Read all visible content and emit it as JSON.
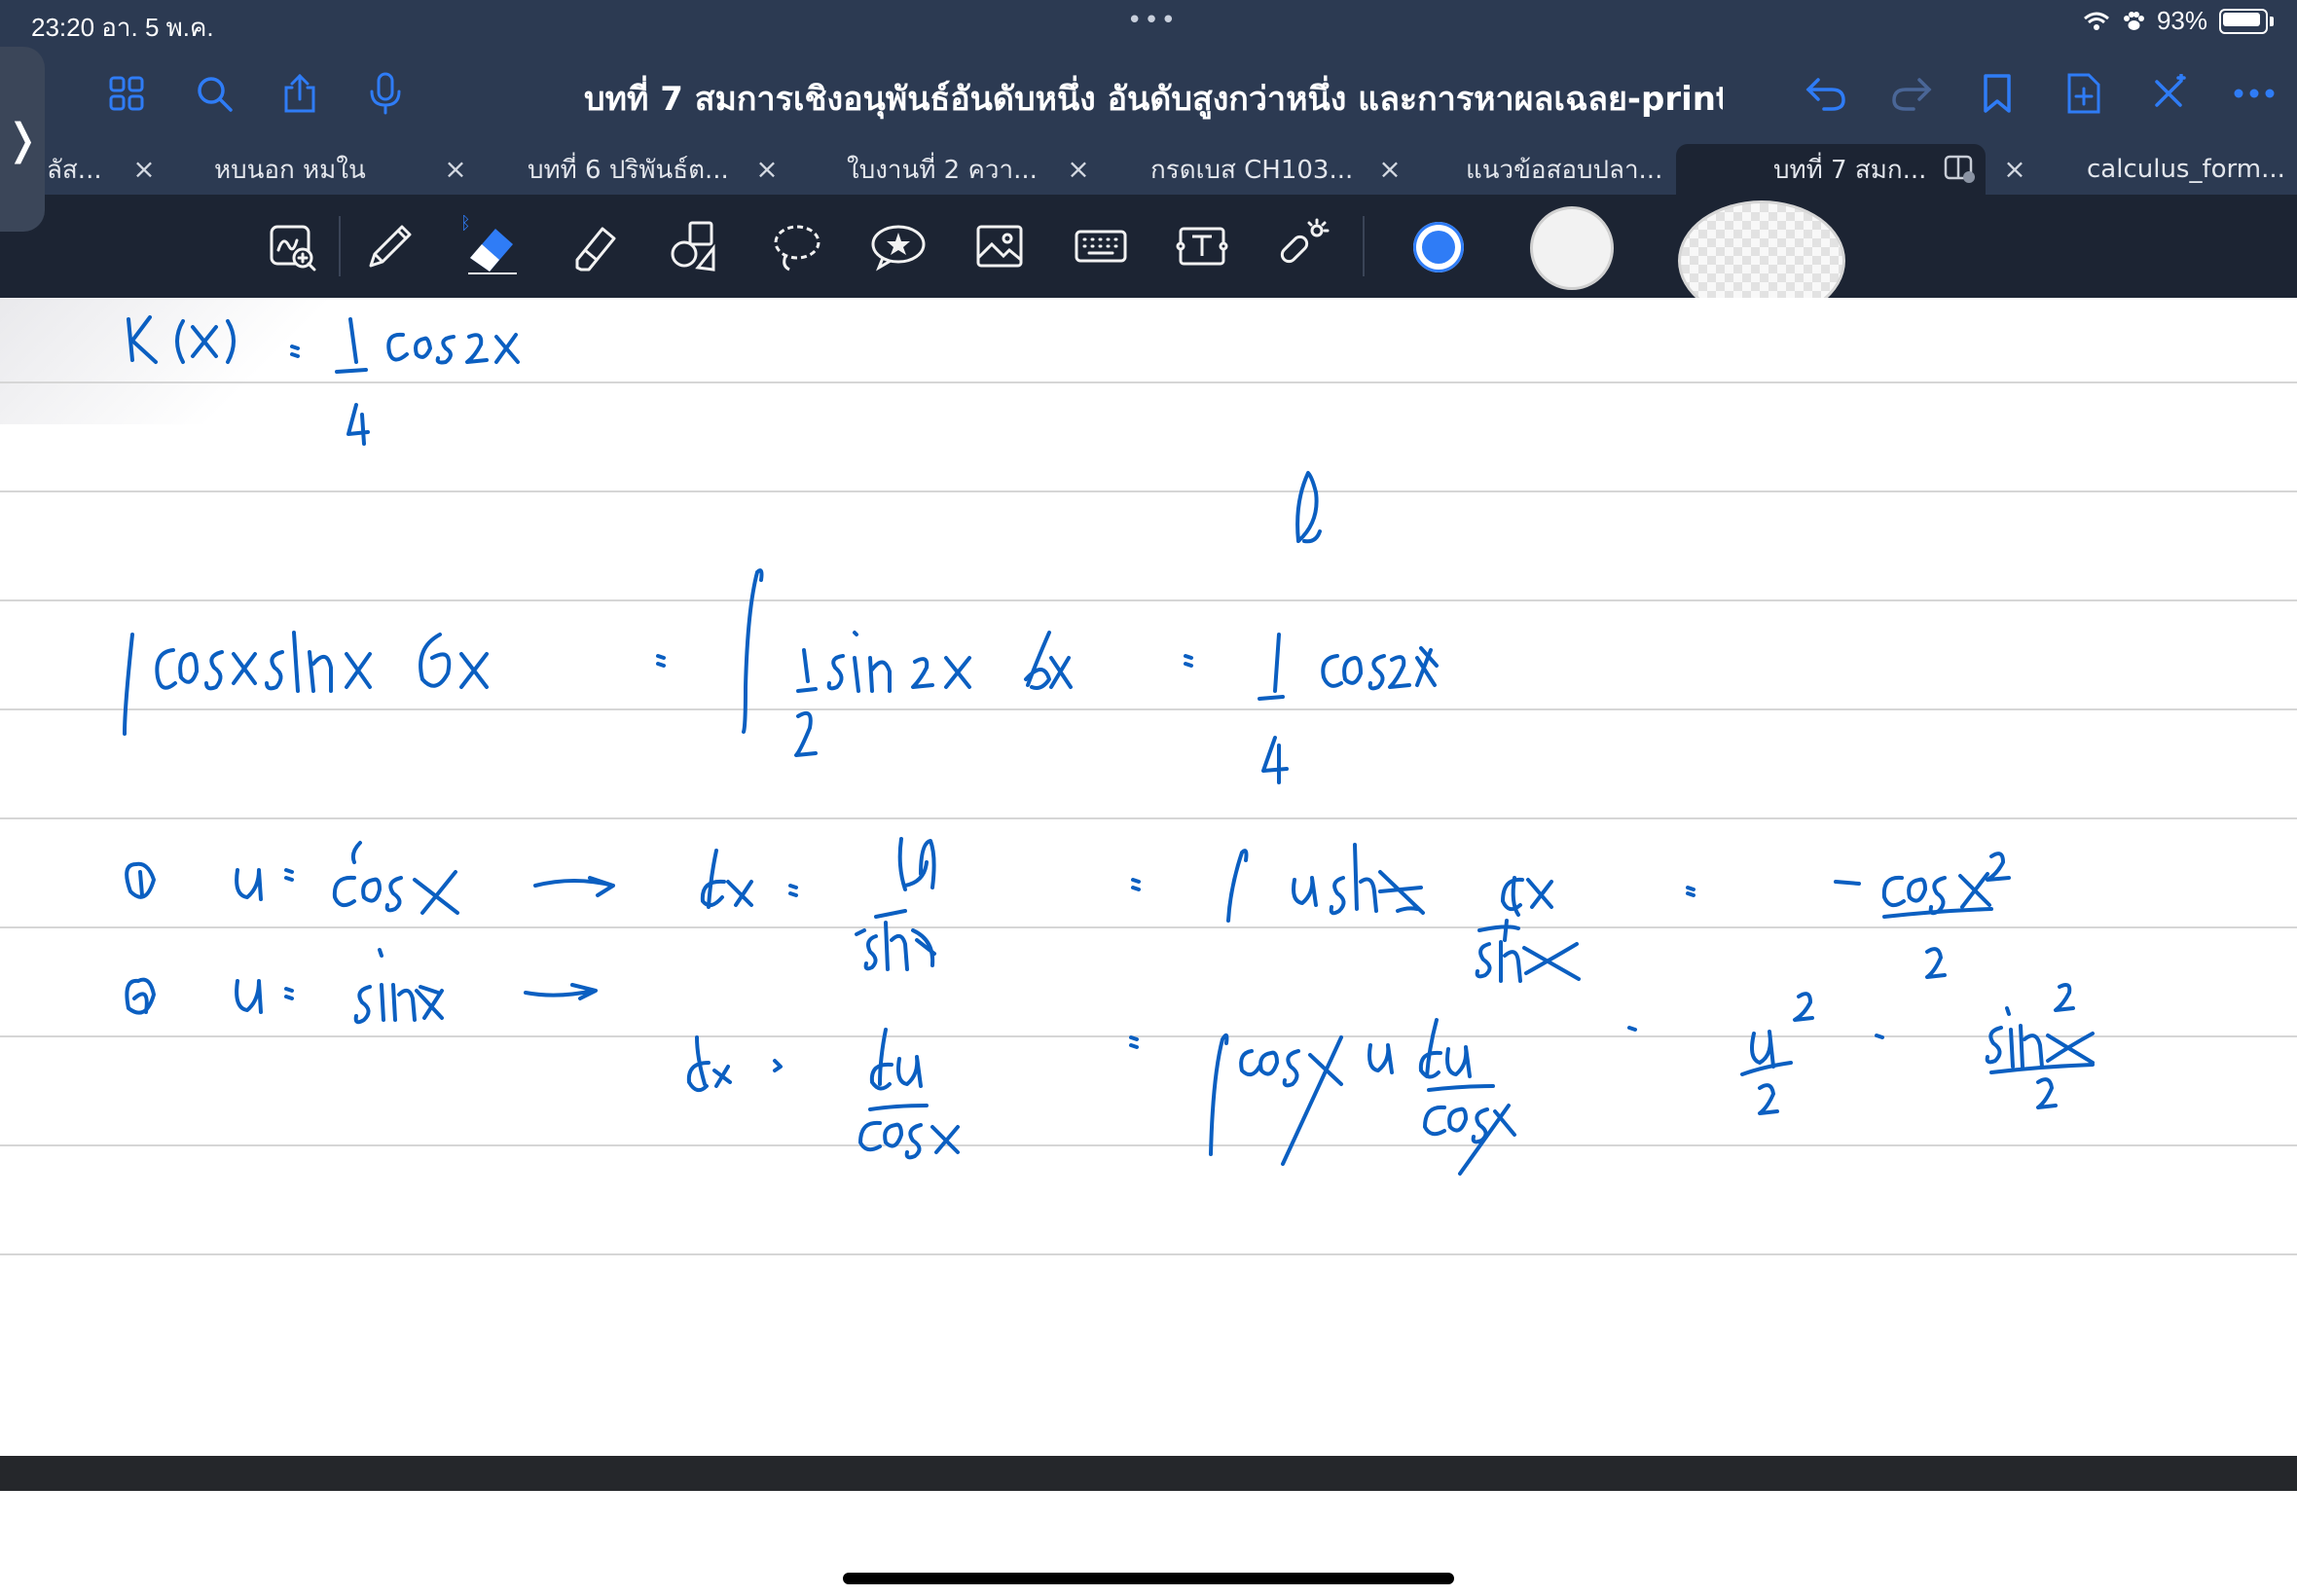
{
  "status_bar": {
    "time_date": "23:20   อา. 5 พ.ค.",
    "dots": "•••",
    "battery_percent": "93%"
  },
  "document": {
    "title": "บทที่ 7 สมการเชิงอนุพันธ์อันดับหนึ่ง อันดับสูงกว่าหนึ่ง และการหาผลเฉลย-print",
    "title_chevron": "⌄"
  },
  "tabs": [
    {
      "label": "ลัส...",
      "active": false
    },
    {
      "label": "หบนอก หมใน",
      "active": false
    },
    {
      "label": "บทที่ 6 ปริพันธ์ต...",
      "active": false
    },
    {
      "label": "ใบงานที่ 2 ควา...",
      "active": false
    },
    {
      "label": "กรดเบส CH103...",
      "active": false
    },
    {
      "label": "แนวข้อสอบปลา...",
      "active": false
    },
    {
      "label": "บทที่ 7 สมก...",
      "active": true
    },
    {
      "label": "calculus_form...",
      "active": false
    }
  ],
  "tab_close_glyph": "×",
  "sidebar_handle_glyph": "❭",
  "colors": {
    "topbar": "#2c3a52",
    "toolbar": "#1c2433",
    "accent": "#2f7cf6",
    "ink": "#0b5fc1",
    "rule": "#d6d6d6"
  },
  "nav_icons": [
    "sidebar-icon",
    "grid-icon",
    "search-icon",
    "share-icon",
    "microphone-icon"
  ],
  "right_icons": [
    "undo-icon",
    "redo-icon",
    "bookmark-icon",
    "add-page-icon",
    "close-editor-icon",
    "more-icon"
  ],
  "tools": [
    "zoom-window-icon",
    "pen-icon",
    "eraser-icon",
    "highlighter-icon",
    "shapes-icon",
    "lasso-icon",
    "sticker-icon",
    "image-icon",
    "keyboard-icon",
    "textbox-icon",
    "laser-pointer-icon"
  ],
  "swatches": [
    "blue-color-swatch",
    "white-color-swatch",
    "checker-color-swatch"
  ]
}
